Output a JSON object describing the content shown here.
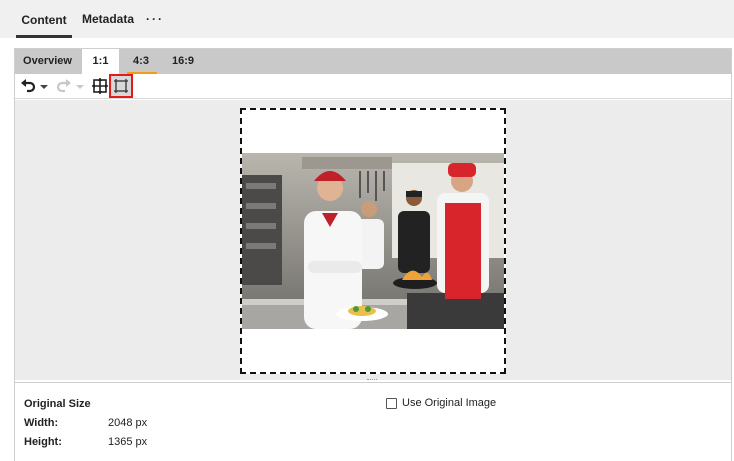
{
  "top_tabs": [
    {
      "label": "Content",
      "active": true
    },
    {
      "label": "Metadata",
      "active": false
    },
    {
      "label": "···",
      "active": false
    }
  ],
  "crop_tabs": [
    {
      "label": "Overview"
    },
    {
      "label": "1:1",
      "active": true
    },
    {
      "label": "4:3",
      "accent": "#f39c1a"
    },
    {
      "label": "16:9"
    }
  ],
  "toolbar": {
    "icons": [
      "undo-icon",
      "dropdown-arrow-icon",
      "redo-icon",
      "dropdown-arrow-icon",
      "fit-to-frame-icon",
      "crop-frame-icon"
    ],
    "highlight_color": "#e21b1b"
  },
  "image": {
    "subject": "chefs-in-kitchen-photo"
  },
  "info": {
    "original_size_label": "Original Size",
    "width_label": "Width:",
    "width_value": "2048 px",
    "height_label": "Height:",
    "height_value": "1365 px",
    "use_original_label": "Use Original Image",
    "use_original_checked": false
  }
}
